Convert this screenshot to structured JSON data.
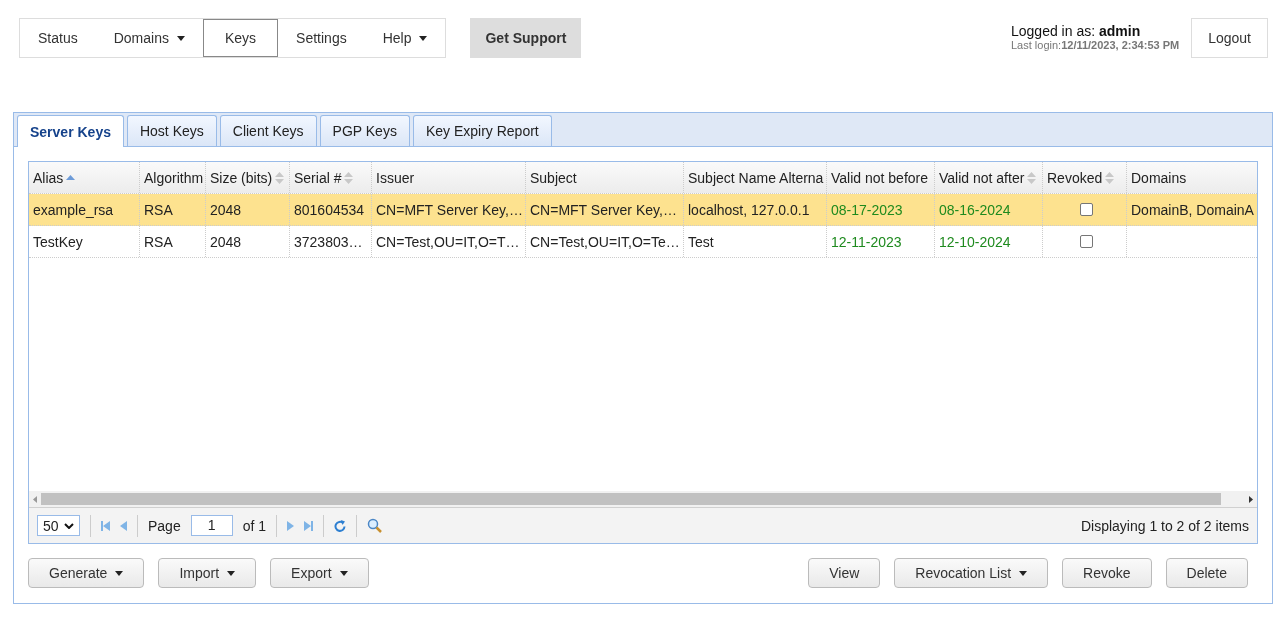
{
  "nav": {
    "items": [
      {
        "label": "Status",
        "selected": false,
        "dropdown": false
      },
      {
        "label": "Domains",
        "selected": false,
        "dropdown": true
      },
      {
        "label": "Keys",
        "selected": true,
        "dropdown": false
      },
      {
        "label": "Settings",
        "selected": false,
        "dropdown": false
      },
      {
        "label": "Help",
        "selected": false,
        "dropdown": true
      }
    ],
    "support_button": "Get Support"
  },
  "user": {
    "logged_in_label": "Logged in as: **admin**",
    "last_login": "Last login:**12/11/2023, 2:34:53 PM**",
    "logout_button": "Logout"
  },
  "tabs": [
    {
      "label": "Server Keys",
      "selected": true
    },
    {
      "label": "Host Keys",
      "selected": false
    },
    {
      "label": "Client Keys",
      "selected": false
    },
    {
      "label": "PGP Keys",
      "selected": false
    },
    {
      "label": "Key Expiry Report",
      "selected": false
    }
  ],
  "table": {
    "columns": [
      {
        "label": "Alias",
        "sorted_ascending": true
      },
      {
        "label": "Algorithm"
      },
      {
        "label": "Size (bits)",
        "sortable": true
      },
      {
        "label": "Serial #",
        "sortable": true
      },
      {
        "label": "Issuer"
      },
      {
        "label": "Subject"
      },
      {
        "label": "Subject Name Alterna"
      },
      {
        "label": "Valid not before"
      },
      {
        "label": "Valid not after",
        "sortable": true
      },
      {
        "label": "Revoked",
        "sortable": true
      },
      {
        "label": "Domains"
      }
    ],
    "rows": [
      {
        "selected": true,
        "alias": "example_rsa",
        "algorithm": "RSA",
        "size": "2048",
        "serial": "801604534",
        "issuer": "CN=MFT Server Key,…",
        "subject": "CN=MFT Server Key,…",
        "san": "localhost, 127.0.0.1",
        "valid_from": "08-17-2023",
        "valid_to": "08-16-2024",
        "revoked": false,
        "domains": "DomainB, DomainA"
      },
      {
        "selected": false,
        "alias": "TestKey",
        "algorithm": "RSA",
        "size": "2048",
        "serial": "3723803…",
        "issuer": "CN=Test,OU=IT,O=T…",
        "subject": "CN=Test,OU=IT,O=Te…",
        "san": "Test",
        "valid_from": "12-11-2023",
        "valid_to": "12-10-2024",
        "revoked": false,
        "domains": ""
      }
    ]
  },
  "pager": {
    "page_size": "50",
    "page_label": "Page",
    "page": "1",
    "of_label": "of 1",
    "summary": "Displaying 1 to 2 of 2 items"
  },
  "actions_left": [
    {
      "label": "Generate",
      "dropdown": true
    },
    {
      "label": "Import",
      "dropdown": true
    },
    {
      "label": "Export",
      "dropdown": true
    }
  ],
  "actions_right": [
    {
      "label": "View",
      "dropdown": false
    },
    {
      "label": "Revocation List",
      "dropdown": true
    },
    {
      "label": "Revoke",
      "dropdown": false
    },
    {
      "label": "Delete",
      "dropdown": false
    }
  ]
}
